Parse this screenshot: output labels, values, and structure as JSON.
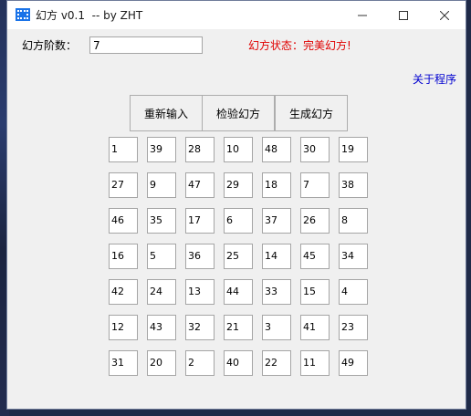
{
  "window": {
    "title": "幻方 v0.1  -- by ZHT"
  },
  "controls": {
    "order_label": "幻方阶数：",
    "order_value": "7",
    "status_label": "幻方状态：",
    "status_value": "完美幻方!",
    "about_link": "关于程序"
  },
  "buttons": {
    "reenter": "重新输入",
    "check": "检验幻方",
    "generate": "生成幻方"
  },
  "grid": [
    [
      "1",
      "39",
      "28",
      "10",
      "48",
      "30",
      "19"
    ],
    [
      "27",
      "9",
      "47",
      "29",
      "18",
      "7",
      "38"
    ],
    [
      "46",
      "35",
      "17",
      "6",
      "37",
      "26",
      "8"
    ],
    [
      "16",
      "5",
      "36",
      "25",
      "14",
      "45",
      "34"
    ],
    [
      "42",
      "24",
      "13",
      "44",
      "33",
      "15",
      "4"
    ],
    [
      "12",
      "43",
      "32",
      "21",
      "3",
      "41",
      "23"
    ],
    [
      "31",
      "20",
      "2",
      "40",
      "22",
      "11",
      "49"
    ]
  ],
  "icons": {
    "app": "grid-app-icon",
    "minimize": "minimize-icon",
    "maximize": "maximize-icon",
    "close": "close-icon"
  },
  "colors": {
    "status": "#e00000",
    "link": "#0000d0",
    "app_icon": "#1a73e8"
  }
}
